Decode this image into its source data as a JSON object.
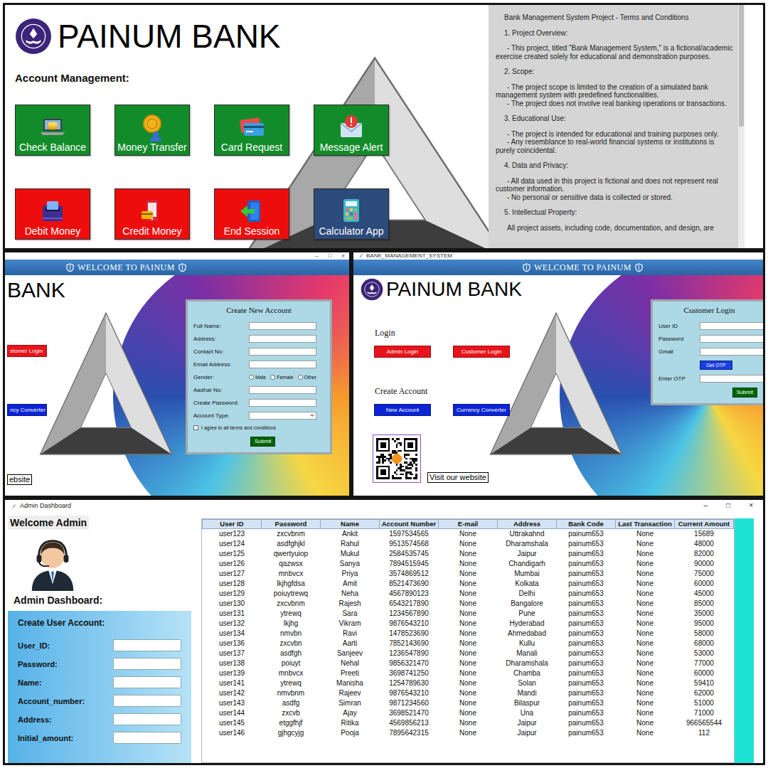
{
  "home": {
    "brand": "PAINUM BANK",
    "section_title": "Account Management:",
    "tiles": [
      {
        "label": "Check Balance",
        "color": "#128c2a"
      },
      {
        "label": "Money Transfer",
        "color": "#128c2a"
      },
      {
        "label": "Card Request",
        "color": "#128c2a"
      },
      {
        "label": "Message Alert",
        "color": "#128c2a"
      },
      {
        "label": "Debit Money",
        "color": "#ee0d0d"
      },
      {
        "label": "Credit Money",
        "color": "#ee0d0d"
      },
      {
        "label": "End Session",
        "color": "#ee0d0d"
      },
      {
        "label": "Calculator App",
        "color": "#2c4a7a"
      }
    ],
    "terms": {
      "scroll_level": 0.5,
      "lines": [
        {
          "kind": "title",
          "text": "Bank Management System Project - Terms and Conditions"
        },
        {
          "kind": "heading",
          "text": "1. Project Overview:"
        },
        {
          "kind": "para",
          "text": "- This project, titled \"Bank Management System,\" is a fictional/academic exercise created solely for educational and demonstration purposes."
        },
        {
          "kind": "heading",
          "text": "2. Scope:"
        },
        {
          "kind": "para",
          "text": "- The project scope is limited to the creation of a simulated bank management system with predefined functionalities."
        },
        {
          "kind": "para",
          "text": "- The project does not involve real banking operations or transactions."
        },
        {
          "kind": "heading",
          "text": "3. Educational Use:"
        },
        {
          "kind": "para",
          "text": "- The project is intended for educational and training purposes only."
        },
        {
          "kind": "para",
          "text": "- Any resemblance to real-world financial systems or institutions is purely coincidental."
        },
        {
          "kind": "heading",
          "text": "4. Data and Privacy:"
        },
        {
          "kind": "para",
          "text": "- All data used in this project is fictional and does not represent real customer information."
        },
        {
          "kind": "para",
          "text": "- No personal or sensitive data is collected or stored."
        },
        {
          "kind": "heading",
          "text": "5. Intellectual Property:"
        },
        {
          "kind": "para",
          "text": "All project assets, including code, documentation, and design, are"
        }
      ]
    }
  },
  "signup": {
    "window_controls": [
      "–",
      "□",
      "×"
    ],
    "banner": "WELCOME TO PAINUM",
    "brand": "BANK",
    "buttons": [
      {
        "label": "stomer Login",
        "color": "#e8141b"
      },
      {
        "label": "ncy Converter",
        "color": "#0a24d6"
      }
    ],
    "website_link": "ebsite",
    "form": {
      "title": "Create New Account",
      "fields": [
        {
          "label": "Full Name:",
          "kind": "text"
        },
        {
          "label": "Address:",
          "kind": "text"
        },
        {
          "label": "Contact No:",
          "kind": "text"
        },
        {
          "label": "Email Address:",
          "kind": "text"
        },
        {
          "label": "Gender:",
          "kind": "radio",
          "options": [
            {
              "label": "Male",
              "selected": false
            },
            {
              "label": "Female",
              "selected": false
            },
            {
              "label": "Other",
              "selected": false
            }
          ]
        },
        {
          "label": "Aadhar No:",
          "kind": "text"
        },
        {
          "label": "Create Password:",
          "kind": "text"
        },
        {
          "label": "Account Type:",
          "kind": "select"
        }
      ],
      "agree": {
        "label": "I agree to all terms and conditions",
        "checked": false
      },
      "submit": "Submit"
    }
  },
  "login": {
    "window_title": "BANK_MANAGEMENT_SYSTEM",
    "banner": "WELCOME TO PAINUM",
    "brand": "PAINUM BANK",
    "login_heading": "Login",
    "login_buttons": [
      {
        "label": "Admin Login",
        "color": "#e8141b"
      },
      {
        "label": "Customer Login",
        "color": "#e8141b"
      }
    ],
    "create_heading": "Create Account",
    "create_buttons": [
      {
        "label": "New Account",
        "color": "#0a24d6"
      },
      {
        "label": "Currency Converter",
        "color": "#0a24d6"
      }
    ],
    "website_link": "Visit our website",
    "form": {
      "title": "Customer Login",
      "fields": [
        {
          "label": "User ID",
          "kind": "text"
        },
        {
          "label": "Password",
          "kind": "text"
        },
        {
          "label": "Gmail",
          "kind": "text"
        },
        {
          "label": "Get OTP",
          "kind": "button"
        },
        {
          "label": "Enter OTP",
          "kind": "text"
        }
      ],
      "submit": "Submit"
    }
  },
  "admin": {
    "window": {
      "title": "Admin Dashboard",
      "controls": [
        "–",
        "□",
        "×"
      ]
    },
    "welcome": "Welcome Admin",
    "dashboard_heading": "Admin Dashboard:",
    "create_form": {
      "title": "Create User Account:",
      "fields": [
        "User_ID:",
        "Password:",
        "Name:",
        "Account_number:",
        "Address:",
        "Initial_amount:"
      ]
    },
    "table": {
      "columns": [
        "User ID",
        "Password",
        "Name",
        "Account Number",
        "E-mail",
        "Address",
        "Bank Code",
        "Last Transaction",
        "Current Amount"
      ],
      "rows": [
        [
          "user123",
          "zxcvbnm",
          "Ankit",
          "1597534565",
          "None",
          "Uttrakahnd",
          "painum653",
          "None",
          "15689"
        ],
        [
          "user124",
          "asdfghjkl",
          "Rahul",
          "9513574568",
          "None",
          "Dharamshala",
          "painum653",
          "None",
          "48000"
        ],
        [
          "user125",
          "qwertyuiop",
          "Mukul",
          "2584535745",
          "None",
          "Jaipur",
          "painum653",
          "None",
          "82000"
        ],
        [
          "user126",
          "qazwsx",
          "Sanya",
          "7894515945",
          "None",
          "Chandigarh",
          "painum653",
          "None",
          "90000"
        ],
        [
          "user127",
          "mnbvcx",
          "Priya",
          "3574869512",
          "None",
          "Mumbai",
          "painum653",
          "None",
          "75000"
        ],
        [
          "user128",
          "lkjhgfdsa",
          "Amit",
          "8521473690",
          "None",
          "Kolkata",
          "painum653",
          "None",
          "60000"
        ],
        [
          "user129",
          "poiuytrewq",
          "Neha",
          "4567890123",
          "None",
          "Delhi",
          "painum653",
          "None",
          "45000"
        ],
        [
          "user130",
          "zxcvbnm",
          "Rajesh",
          "6543217890",
          "None",
          "Bangalore",
          "painum653",
          "None",
          "85000"
        ],
        [
          "user131",
          "ytrewq",
          "Sara",
          "1234567890",
          "None",
          "Pune",
          "painum653",
          "None",
          "35000"
        ],
        [
          "user132",
          "lkjhg",
          "Vikram",
          "9876543210",
          "None",
          "Hyderabad",
          "painum653",
          "None",
          "95000"
        ],
        [
          "user134",
          "nmvbn",
          "Ravi",
          "1478523690",
          "None",
          "Ahmedabad",
          "painum653",
          "None",
          "58000"
        ],
        [
          "user136",
          "zxcvbn",
          "Aarti",
          "7852143690",
          "None",
          "Kullu",
          "painum653",
          "None",
          "68000"
        ],
        [
          "user137",
          "asdfgh",
          "Sanjeev",
          "1236547890",
          "None",
          "Manali",
          "painum653",
          "None",
          "53000"
        ],
        [
          "user138",
          "poiuyt",
          "Nehal",
          "9856321470",
          "None",
          "Dharamshala",
          "painum653",
          "None",
          "77000"
        ],
        [
          "user139",
          "mnbvcx",
          "Preeti",
          "3698741250",
          "None",
          "Chamba",
          "painum653",
          "None",
          "60000"
        ],
        [
          "user141",
          "ytrewq",
          "Manisha",
          "1254789630",
          "None",
          "Solan",
          "painum653",
          "None",
          "59410"
        ],
        [
          "user142",
          "nmvbnm",
          "Rajeev",
          "9876543210",
          "None",
          "Mandi",
          "painum653",
          "None",
          "62000"
        ],
        [
          "user143",
          "asdfg",
          "Simran",
          "9871234560",
          "None",
          "Bilaspur",
          "painum653",
          "None",
          "51000"
        ],
        [
          "user144",
          "zxcvb",
          "Ajay",
          "3698521470",
          "None",
          "Una",
          "painum653",
          "None",
          "71000"
        ],
        [
          "user145",
          "etggfhjf",
          "Ritika",
          "4569856213",
          "None",
          "Jaipur",
          "painum653",
          "None",
          "966565544"
        ],
        [
          "user146",
          "gjhgcyjg",
          "Pooja",
          "7895642315",
          "None",
          "Jaipur",
          "painum653",
          "None",
          "112"
        ]
      ]
    }
  }
}
